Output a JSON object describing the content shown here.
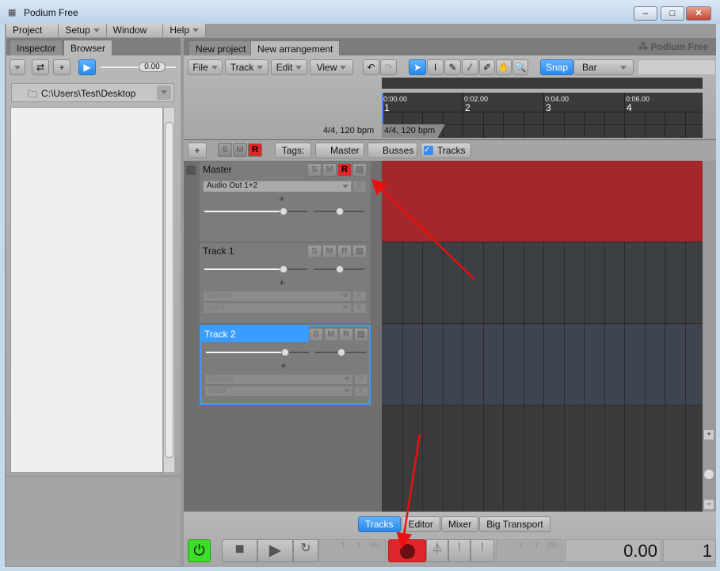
{
  "window": {
    "title": "Podium Free"
  },
  "menu": [
    "Project",
    "Setup",
    "Window",
    "Help"
  ],
  "left": {
    "tabs": [
      "Inspector",
      "Browser"
    ],
    "volume": "0.00",
    "path": "C:\\Users\\Test\\Desktop"
  },
  "main": {
    "tabs": [
      "New project",
      "New arrangement"
    ],
    "brand": "Podium Free",
    "toolbar": {
      "menus": [
        "File",
        "Track",
        "Edit",
        "View"
      ],
      "snap": "Snap",
      "grid": "Bar"
    },
    "timeline": {
      "times": [
        "0:00.00",
        "0:02.00",
        "0:04.00",
        "0:06.00"
      ],
      "bars": [
        "1",
        "2",
        "3",
        "4"
      ],
      "signature": "4/4, 120 bpm",
      "signature_marker": "4/4, 120 bpm"
    },
    "tagbar": {
      "plus": "+",
      "s": "S",
      "m": "M",
      "r": "R",
      "tags_label": "Tags:",
      "tags": [
        {
          "label": "Master",
          "checked": false
        },
        {
          "label": "Busses",
          "checked": false
        },
        {
          "label": "Tracks",
          "checked": true
        }
      ]
    },
    "tracks": [
      {
        "name": "Master",
        "output": "Audio Out 1+2",
        "armed": true,
        "color": "#a3272b"
      },
      {
        "name": "Track 1",
        "source": "Source",
        "input": "Input",
        "armed": false,
        "color": "#3d4043"
      },
      {
        "name": "Track 2",
        "source": "Source",
        "input": "Input",
        "armed": false,
        "selected": true,
        "color": "#3e4550"
      }
    ],
    "track_buttons": {
      "s": "S",
      "m": "M",
      "r": "R",
      "x": "X",
      "plus": "+"
    },
    "bottom_tabs": [
      {
        "label": "Tracks",
        "active": true
      },
      {
        "label": "Editor"
      },
      {
        "label": "Mixer"
      },
      {
        "label": "Big Transport"
      }
    ],
    "transport": {
      "time": "0.00",
      "bar": "1",
      "counter1": [
        "1",
        "1",
        "0%"
      ],
      "counter2": [
        "1",
        "1",
        "0%"
      ]
    }
  }
}
